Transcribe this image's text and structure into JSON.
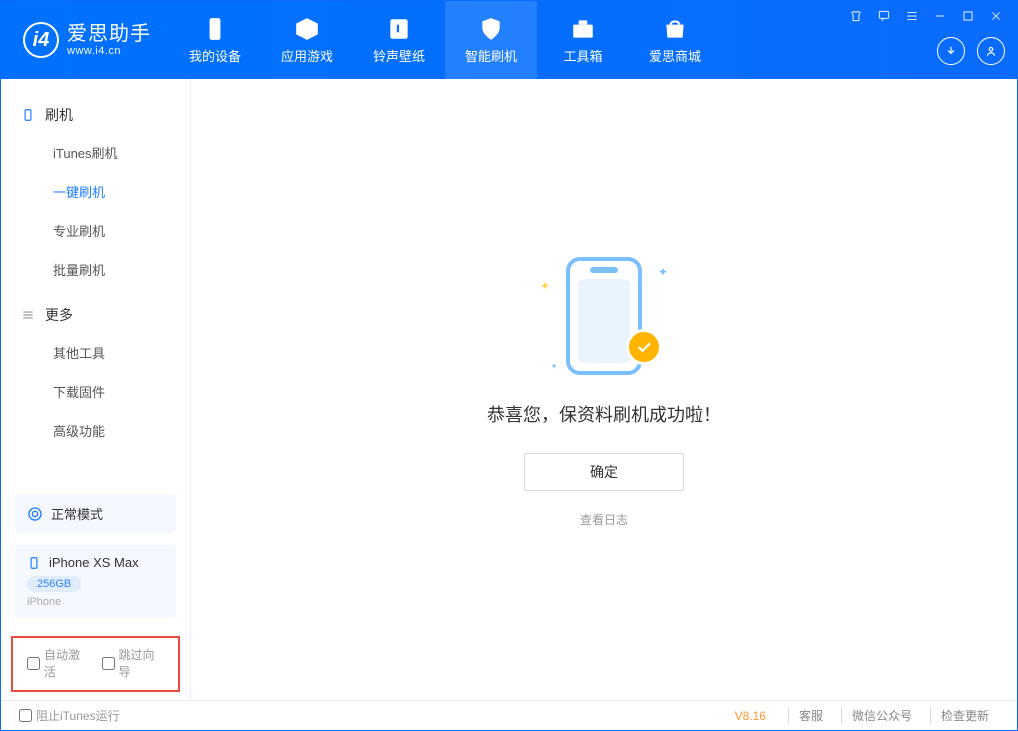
{
  "app": {
    "name_cn": "爱思助手",
    "name_en": "www.i4.cn"
  },
  "tabs": {
    "device": "我的设备",
    "apps": "应用游戏",
    "ring": "铃声壁纸",
    "flash": "智能刷机",
    "tools": "工具箱",
    "store": "爱思商城"
  },
  "sidebar": {
    "flash_head": "刷机",
    "items": {
      "itunes": "iTunes刷机",
      "oneclick": "一键刷机",
      "pro": "专业刷机",
      "batch": "批量刷机"
    },
    "more_head": "更多",
    "more": {
      "other": "其他工具",
      "firmware": "下载固件",
      "advanced": "高级功能"
    }
  },
  "device": {
    "mode": "正常模式",
    "name": "iPhone XS Max",
    "capacity": "256GB",
    "type": "iPhone"
  },
  "checks": {
    "auto_activate": "自动激活",
    "skip_guide": "跳过向导"
  },
  "main": {
    "title": "恭喜您，保资料刷机成功啦！",
    "ok": "确定",
    "log": "查看日志"
  },
  "footer": {
    "block_itunes": "阻止iTunes运行",
    "version": "V8.16",
    "service": "客服",
    "wechat": "微信公众号",
    "update": "检查更新"
  }
}
